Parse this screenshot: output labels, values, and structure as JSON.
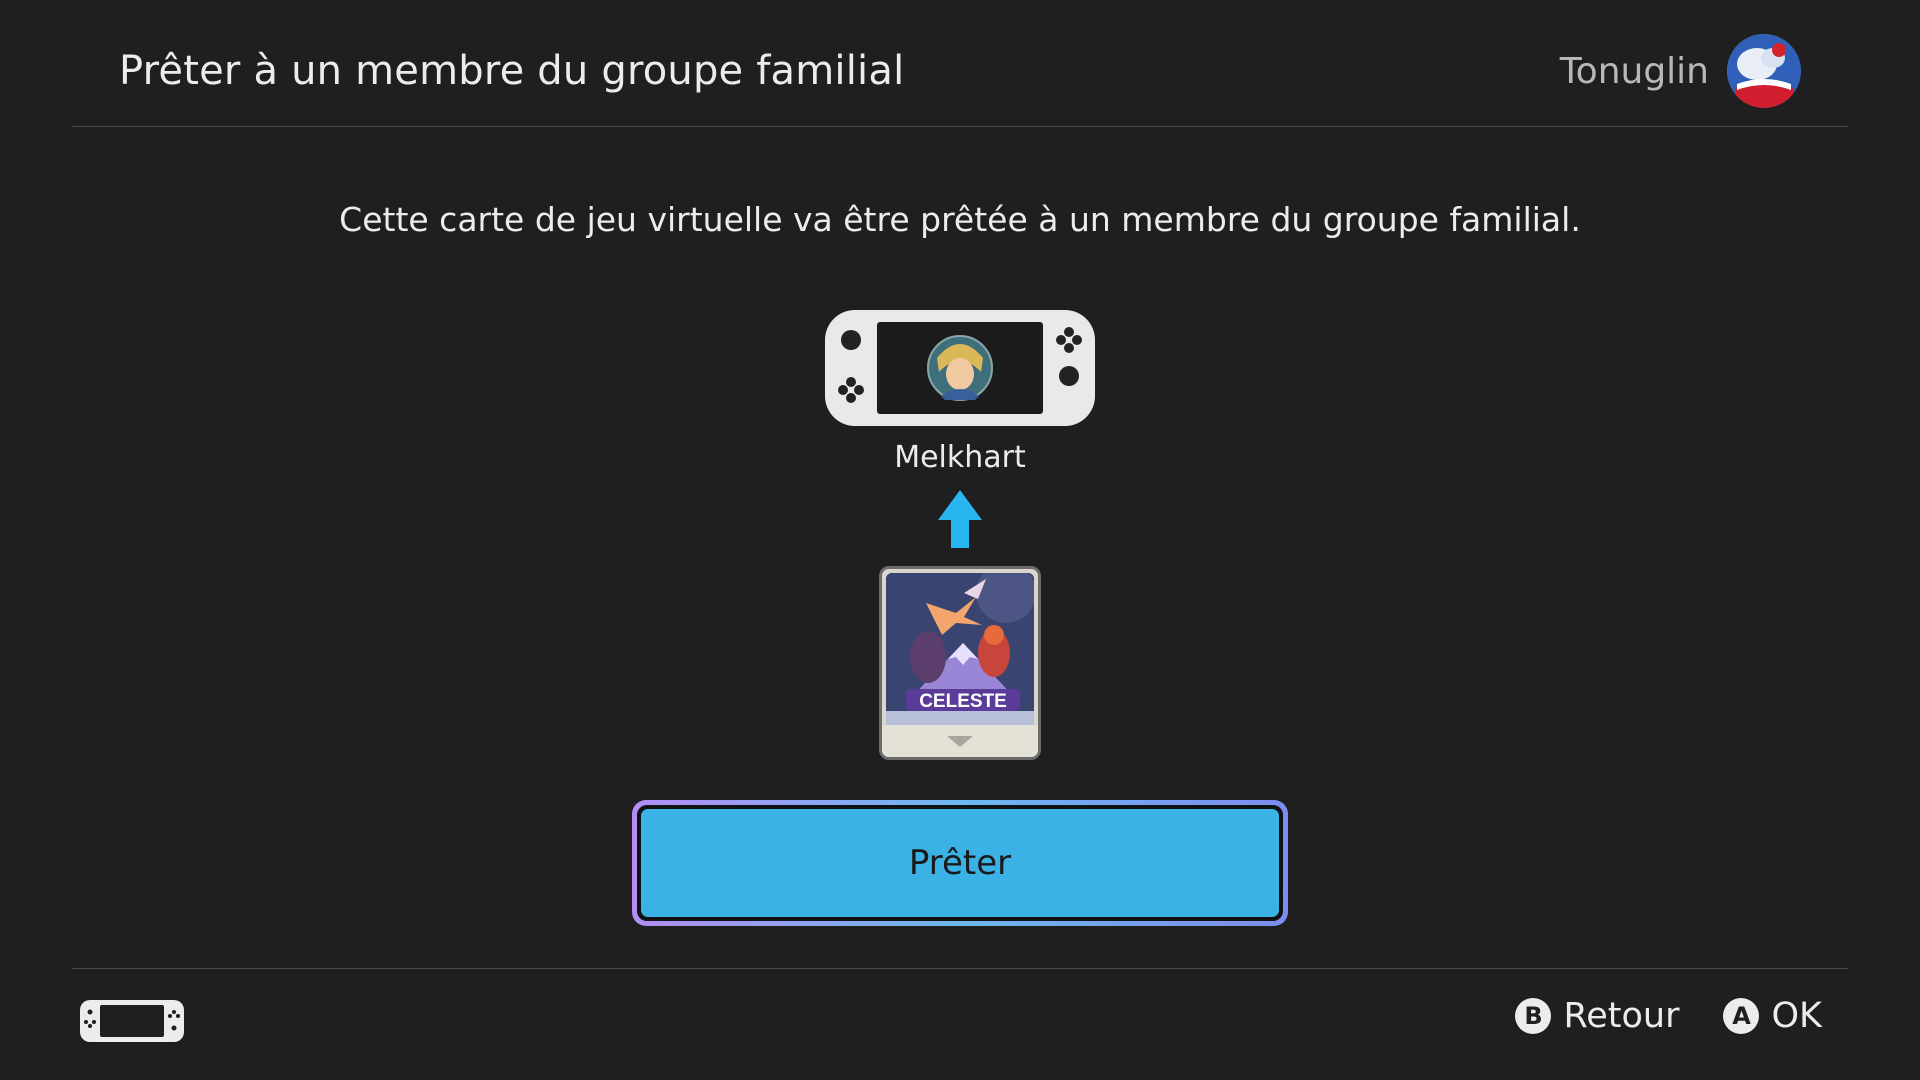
{
  "header": {
    "title": "Prêter à un membre du groupe familial",
    "user_name": "Tonuglin"
  },
  "message": "Cette carte de jeu virtuelle va être prêtée à un membre du groupe familial.",
  "recipient": {
    "name": "Melkhart"
  },
  "game_card": {
    "title": "CELESTE"
  },
  "primary_button": {
    "label": "Prêter"
  },
  "footer": {
    "actions": [
      {
        "button": "B",
        "label": "Retour"
      },
      {
        "button": "A",
        "label": "OK"
      }
    ]
  },
  "colors": {
    "background": "#1f1f1f",
    "accent": "#3bb2e6",
    "arrow": "#29b6f0"
  }
}
